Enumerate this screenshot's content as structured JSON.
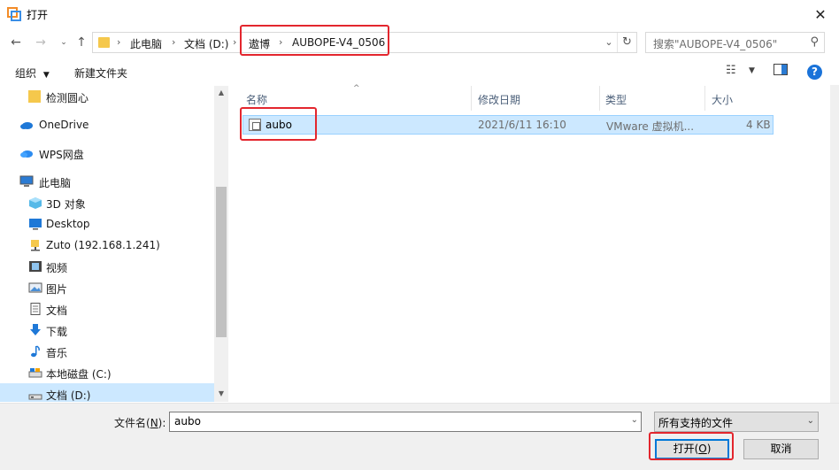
{
  "window": {
    "title": "打开",
    "close_glyph": "✕"
  },
  "address": {
    "crumbs": [
      "此电脑",
      "文档 (D:)",
      "遨博",
      "AUBOPE-V4_0506"
    ],
    "separator": "›",
    "search_placeholder": "搜索\"AUBOPE-V4_0506\""
  },
  "toolbar": {
    "organize_label": "组织",
    "new_folder_label": "新建文件夹"
  },
  "nav": {
    "items": [
      {
        "label": "检测圆心",
        "icon": "folder-icon"
      },
      {
        "label": "OneDrive",
        "icon": "cloud-icon"
      },
      {
        "label": "WPS网盘",
        "icon": "cloud-icon"
      },
      {
        "label": "此电脑",
        "icon": "computer-icon"
      },
      {
        "label": "3D 对象",
        "icon": "cube-icon"
      },
      {
        "label": "Desktop",
        "icon": "desktop-icon"
      },
      {
        "label": "Zuto (192.168.1.241)",
        "icon": "network-folder-icon"
      },
      {
        "label": "视频",
        "icon": "video-icon"
      },
      {
        "label": "图片",
        "icon": "picture-icon"
      },
      {
        "label": "文档",
        "icon": "document-icon"
      },
      {
        "label": "下载",
        "icon": "download-icon"
      },
      {
        "label": "音乐",
        "icon": "music-icon"
      },
      {
        "label": "本地磁盘 (C:)",
        "icon": "drive-icon"
      },
      {
        "label": "文档 (D:)",
        "icon": "drive-icon"
      }
    ]
  },
  "columns": {
    "name": "名称",
    "modified": "修改日期",
    "type": "类型",
    "size": "大小"
  },
  "files": [
    {
      "name": "aubo",
      "modified": "2021/6/11 16:10",
      "type": "VMware 虚拟机...",
      "size": "4 KB"
    }
  ],
  "bottom": {
    "filename_label": "文件名(",
    "filename_key": "N",
    "filename_label_end": "):",
    "filename_value": "aubo",
    "filetype_value": "所有支持的文件",
    "open_label": "打开(",
    "open_key": "O",
    "open_label_end": ")",
    "cancel_label": "取消"
  },
  "colors": {
    "highlight": "#e3262e",
    "selection": "#cce8ff",
    "accent": "#0078d7"
  }
}
